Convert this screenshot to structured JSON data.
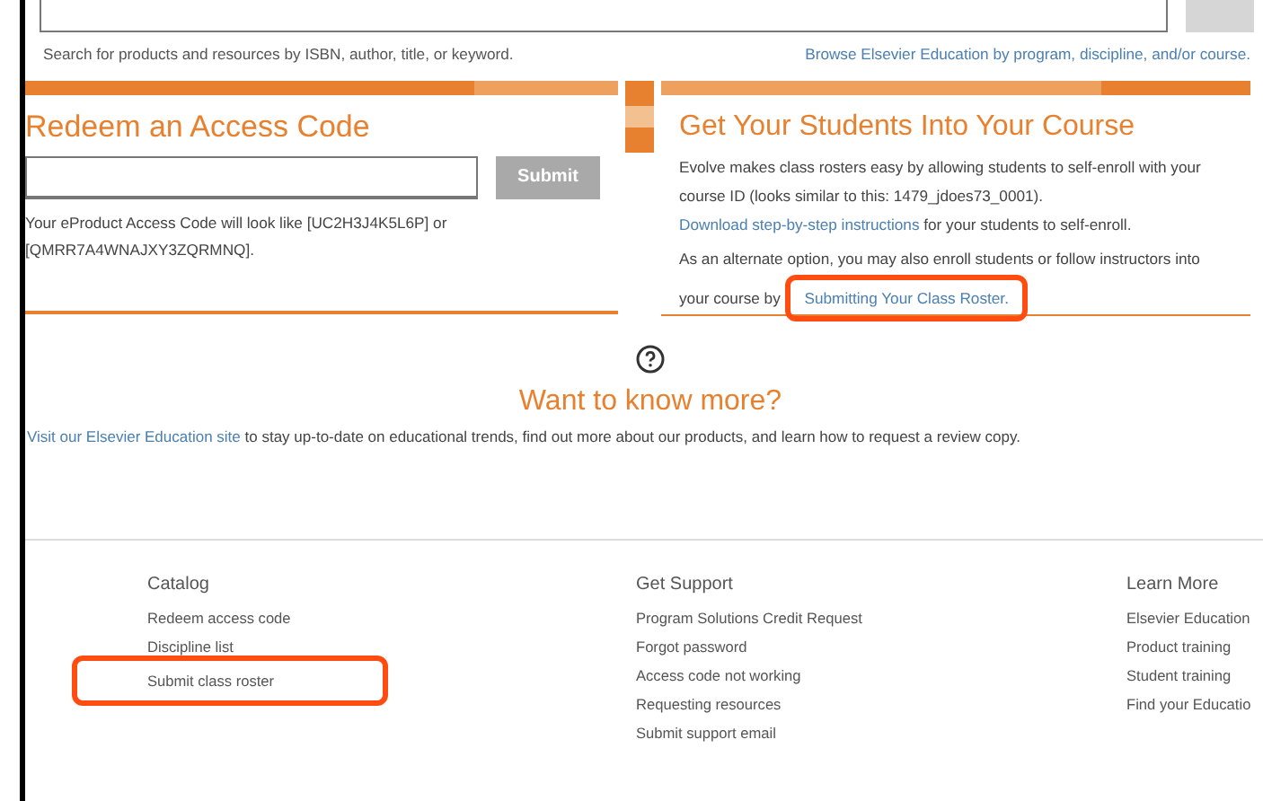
{
  "search": {
    "hint": "Search for products and resources by ISBN, author, title, or keyword.",
    "browse_link": "Browse Elsevier Education by program, discipline, and/or course."
  },
  "redeem": {
    "title": "Redeem an Access Code",
    "submit": "Submit",
    "note": "Your eProduct Access Code will look like [UC2H3J4K5L6P] or [QMRR7A4WNAJXY3ZQRMNQ]."
  },
  "students": {
    "title": "Get Your Students Into Your Course",
    "intro": "Evolve makes class rosters easy by allowing students to self-enroll with your course ID (looks similar to this: 1479_jdoes73_0001).",
    "download_link": "Download step-by-step instructions",
    "download_rest": " for your students to self-enroll.",
    "alt_text": "As an alternate option, you may also enroll students or follow instructors into your course by ",
    "roster_link": "Submitting Your Class Roster.",
    "roster_highlighted": true
  },
  "more": {
    "title": "Want to know more?",
    "link": "Visit our Elsevier Education site",
    "rest": " to stay up-to-date on educational trends, find out more about our products, and learn how to request a review copy."
  },
  "footer": [
    {
      "heading": "Catalog",
      "links": [
        {
          "text": "Redeem access code",
          "highlighted": false
        },
        {
          "text": "Discipline list",
          "highlighted": false
        },
        {
          "text": "Submit class roster",
          "highlighted": true
        }
      ]
    },
    {
      "heading": "Get Support",
      "links": [
        {
          "text": "Program Solutions Credit Request",
          "highlighted": false
        },
        {
          "text": "Forgot password",
          "highlighted": false
        },
        {
          "text": "Access code not working",
          "highlighted": false
        },
        {
          "text": "Requesting resources",
          "highlighted": false
        },
        {
          "text": "Submit support email",
          "highlighted": false
        }
      ]
    },
    {
      "heading": "Learn More",
      "links": [
        {
          "text": "Elsevier Education",
          "highlighted": false
        },
        {
          "text": "Product training",
          "highlighted": false
        },
        {
          "text": "Student training",
          "highlighted": false
        },
        {
          "text": "Find your Educatio",
          "highlighted": false
        }
      ]
    }
  ]
}
